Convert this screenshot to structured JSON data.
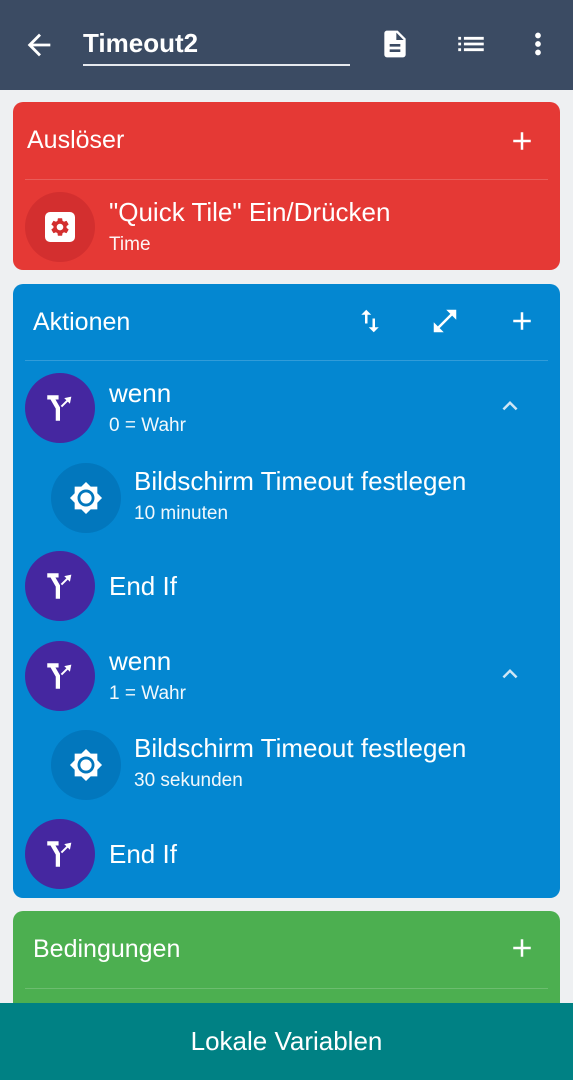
{
  "appbar": {
    "title": "Timeout2",
    "icons": [
      "back-arrow-icon",
      "description-icon",
      "list-icon",
      "more-vert-icon"
    ]
  },
  "triggers": {
    "title": "Auslöser",
    "items": [
      {
        "title": "\"Quick Tile\" Ein/Drücken",
        "subtitle": "Time",
        "icon": "settings-gear-icon"
      }
    ]
  },
  "actions": {
    "title": "Aktionen",
    "items": [
      {
        "title": "wenn",
        "subtitle": "0 = Wahr",
        "icon": "branch-icon",
        "indent": 0,
        "expanded": true
      },
      {
        "title": "Bildschirm Timeout festlegen",
        "subtitle": "10 minuten",
        "icon": "brightness-icon",
        "indent": 1
      },
      {
        "title": "End If",
        "icon": "branch-icon",
        "indent": 0
      },
      {
        "title": "wenn",
        "subtitle": "1 = Wahr",
        "icon": "branch-icon",
        "indent": 0,
        "expanded": true
      },
      {
        "title": "Bildschirm Timeout festlegen",
        "subtitle": "30 sekunden",
        "icon": "brightness-icon",
        "indent": 1
      },
      {
        "title": "End If",
        "icon": "branch-icon",
        "indent": 0
      }
    ]
  },
  "constraints": {
    "title": "Bedingungen"
  },
  "bottom_bar": {
    "label": "Lokale Variablen"
  },
  "colors": {
    "appbar": "#3b4b63",
    "triggers": "#e53935",
    "actions": "#0487d1",
    "constraints": "#4caf50",
    "bottom_bar": "#008184",
    "branch_circle": "#4527a0",
    "action_circle": "#0277bd"
  }
}
